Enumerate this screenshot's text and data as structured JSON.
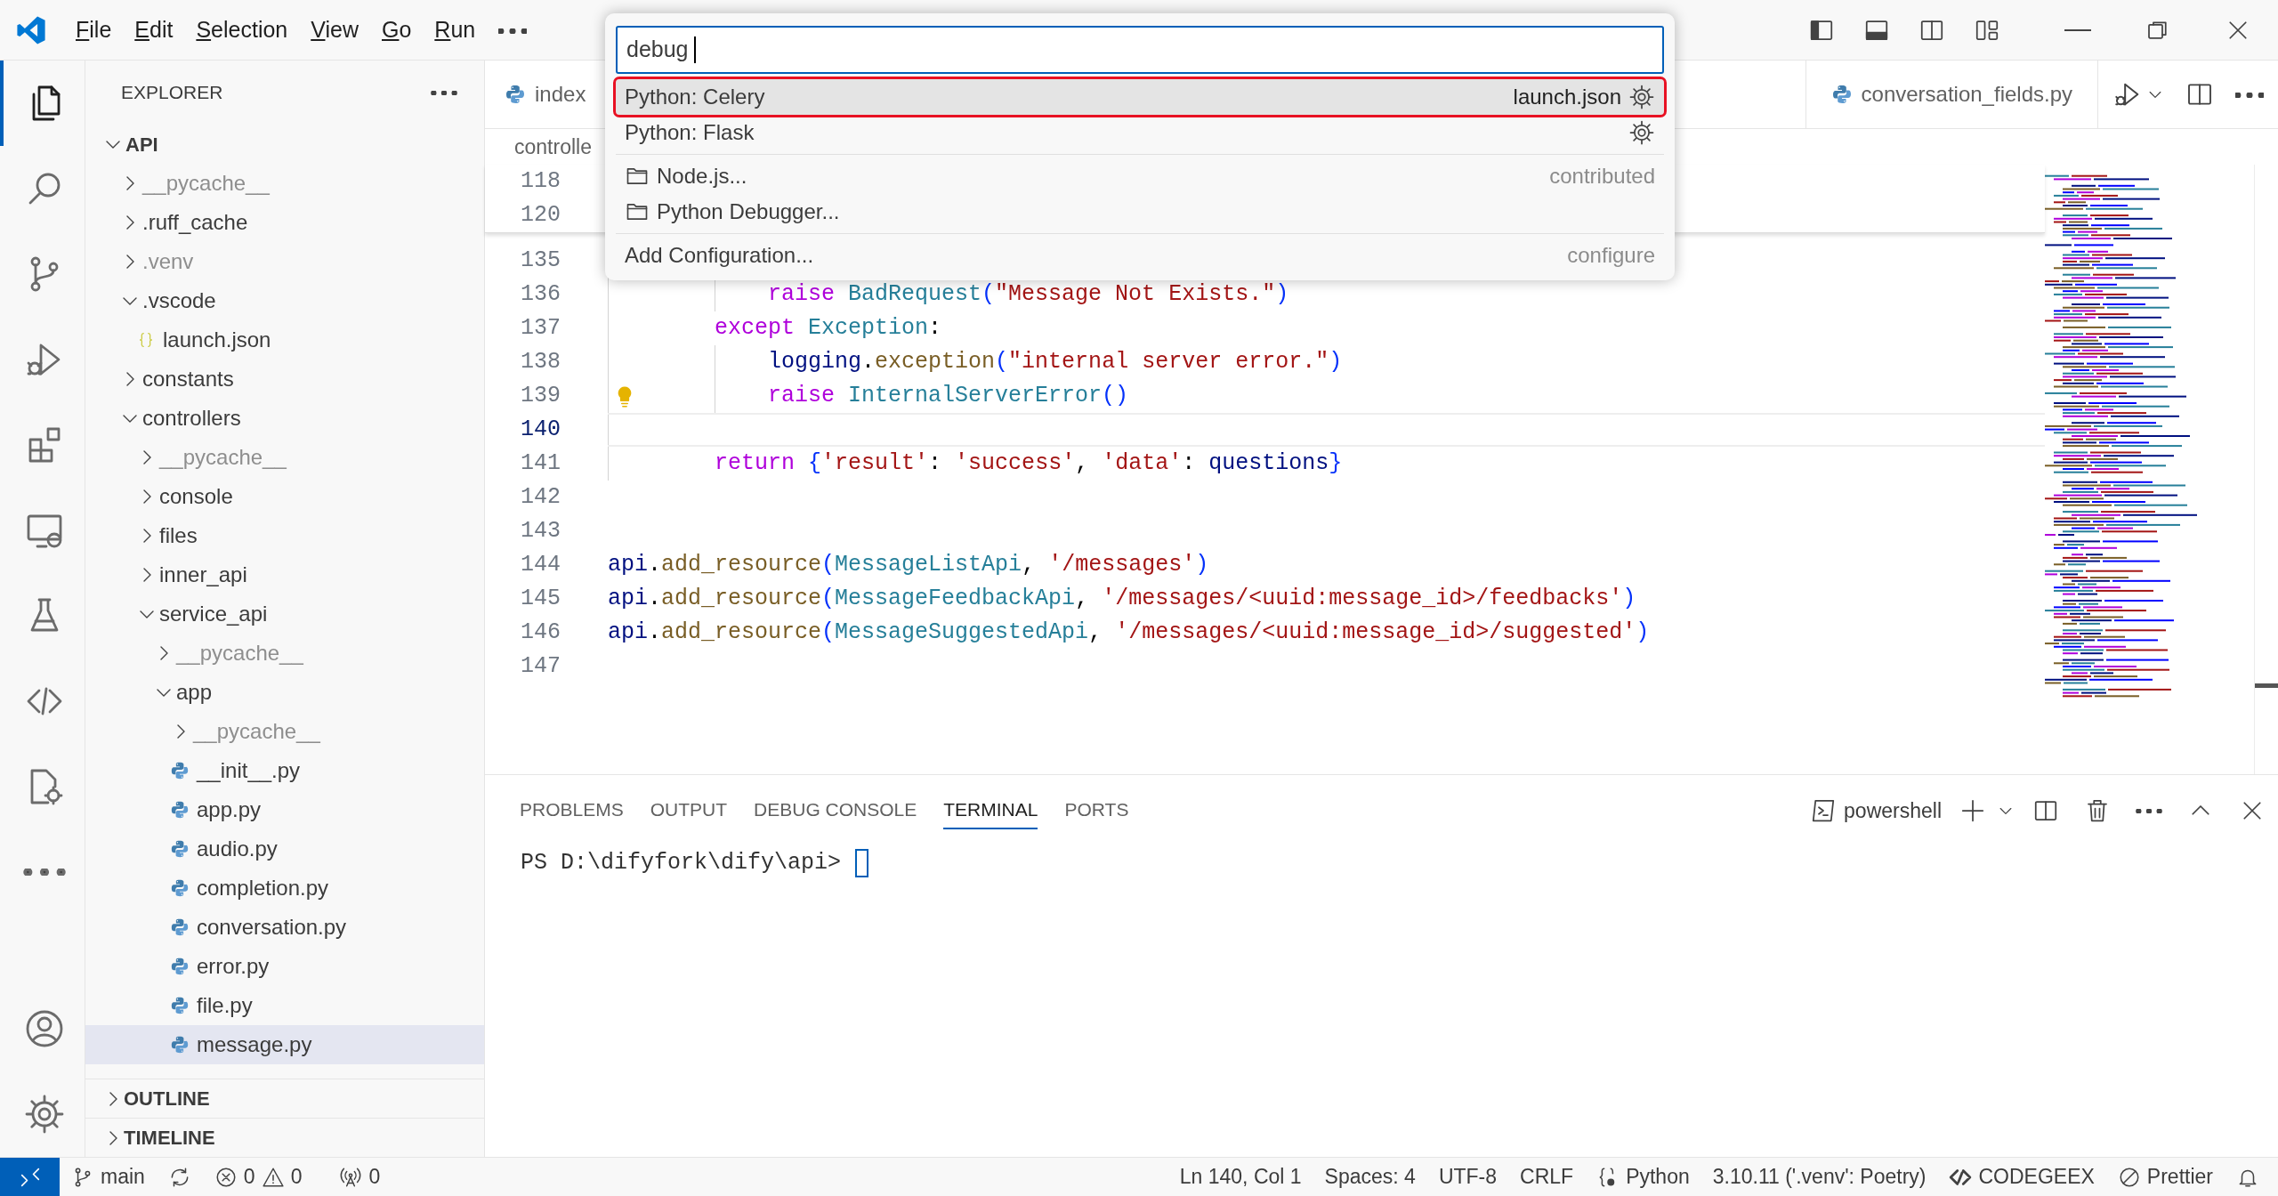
{
  "menu": [
    "File",
    "Edit",
    "Selection",
    "View",
    "Go",
    "Run"
  ],
  "quick_pick": {
    "value": "debug",
    "items": [
      {
        "label": "Python: Celery",
        "detail": "launch.json",
        "kind": "config",
        "selected": true
      },
      {
        "label": "Python: Flask",
        "kind": "config",
        "selected": false
      },
      {
        "label": "Node.js...",
        "detail": "contributed",
        "kind": "folder",
        "selected": false
      },
      {
        "label": "Python Debugger...",
        "kind": "folder",
        "selected": false
      },
      {
        "label": "Add Configuration...",
        "detail": "configure",
        "kind": "action",
        "selected": false
      }
    ]
  },
  "activity_bar": [
    {
      "kind": "explorer",
      "selected": true
    },
    {
      "kind": "search",
      "selected": false
    },
    {
      "kind": "source-control",
      "selected": false
    },
    {
      "kind": "run-debug",
      "selected": false
    },
    {
      "kind": "extensions",
      "selected": false
    },
    {
      "kind": "remote",
      "selected": false
    },
    {
      "kind": "testing",
      "selected": false
    },
    {
      "kind": "codegeex",
      "selected": false
    },
    {
      "kind": "doc-gear",
      "selected": false
    },
    {
      "kind": "more",
      "selected": false
    }
  ],
  "explorer": {
    "title": "EXPLORER",
    "workspace": {
      "label": "API",
      "expanded": true
    },
    "tree": [
      {
        "label": "__pycache__",
        "kind": "folder",
        "expanded": false,
        "dimmed": true,
        "selected": false
      },
      {
        "label": ".ruff_cache",
        "kind": "folder",
        "expanded": false,
        "dimmed": false,
        "selected": false
      },
      {
        "label": ".venv",
        "kind": "folder",
        "expanded": false,
        "dimmed": true,
        "selected": false
      },
      {
        "label": ".vscode",
        "kind": "folder",
        "expanded": true,
        "dimmed": false,
        "selected": false,
        "children": [
          {
            "label": "launch.json",
            "kind": "json",
            "dimmed": false,
            "selected": false
          }
        ]
      },
      {
        "label": "constants",
        "kind": "folder",
        "expanded": false,
        "dimmed": false,
        "selected": false
      },
      {
        "label": "controllers",
        "kind": "folder",
        "expanded": true,
        "dimmed": false,
        "selected": false,
        "children": [
          {
            "label": "__pycache__",
            "kind": "folder",
            "expanded": false,
            "dimmed": true,
            "selected": false
          },
          {
            "label": "console",
            "kind": "folder",
            "expanded": false,
            "dimmed": false,
            "selected": false
          },
          {
            "label": "files",
            "kind": "folder",
            "expanded": false,
            "dimmed": false,
            "selected": false
          },
          {
            "label": "inner_api",
            "kind": "folder",
            "expanded": false,
            "dimmed": false,
            "selected": false
          },
          {
            "label": "service_api",
            "kind": "folder",
            "expanded": true,
            "dimmed": false,
            "selected": false,
            "children": [
              {
                "label": "__pycache__",
                "kind": "folder",
                "expanded": false,
                "dimmed": true,
                "selected": false
              },
              {
                "label": "app",
                "kind": "folder",
                "expanded": true,
                "dimmed": false,
                "selected": false,
                "children": [
                  {
                    "label": "__pycache__",
                    "kind": "folder",
                    "expanded": false,
                    "dimmed": true,
                    "selected": false
                  },
                  {
                    "label": "__init__.py",
                    "kind": "python",
                    "dimmed": false,
                    "selected": false
                  },
                  {
                    "label": "app.py",
                    "kind": "python",
                    "dimmed": false,
                    "selected": false
                  },
                  {
                    "label": "audio.py",
                    "kind": "python",
                    "dimmed": false,
                    "selected": false
                  },
                  {
                    "label": "completion.py",
                    "kind": "python",
                    "dimmed": false,
                    "selected": false
                  },
                  {
                    "label": "conversation.py",
                    "kind": "python",
                    "dimmed": false,
                    "selected": false
                  },
                  {
                    "label": "error.py",
                    "kind": "python",
                    "dimmed": false,
                    "selected": false
                  },
                  {
                    "label": "file.py",
                    "kind": "python",
                    "dimmed": false,
                    "selected": false
                  },
                  {
                    "label": "message.py",
                    "kind": "python",
                    "dimmed": false,
                    "selected": true
                  }
                ]
              }
            ]
          }
        ]
      }
    ],
    "sections": [
      {
        "label": "OUTLINE",
        "expanded": false
      },
      {
        "label": "TIMELINE",
        "expanded": false
      }
    ]
  },
  "editor": {
    "tabs": [
      {
        "label": "index",
        "selected": false
      },
      {
        "label": "conversation_fields.py",
        "selected": false
      }
    ],
    "breadcrumb": "controlle",
    "sticky_lines": [
      "118",
      "120"
    ],
    "lines": [
      {
        "number": "135",
        "current": false,
        "lightbulb": false
      },
      {
        "number": "136",
        "current": false,
        "lightbulb": false,
        "tokens": [
          {
            "kind": "keyword",
            "text": "            raise"
          },
          {
            "kind": "class",
            "text": " BadRequest"
          },
          {
            "kind": "bracket",
            "text": "("
          },
          {
            "kind": "string",
            "text": "\"Message Not Exists.\""
          },
          {
            "kind": "bracket",
            "text": ")"
          }
        ]
      },
      {
        "number": "137",
        "current": false,
        "lightbulb": false,
        "tokens": [
          {
            "kind": "keyword",
            "text": "        except"
          },
          {
            "kind": "class",
            "text": " Exception"
          },
          {
            "kind": "plain",
            "text": ":"
          }
        ]
      },
      {
        "number": "138",
        "current": false,
        "lightbulb": false,
        "tokens": [
          {
            "kind": "variable",
            "text": "            logging"
          },
          {
            "kind": "plain",
            "text": "."
          },
          {
            "kind": "function",
            "text": "exception"
          },
          {
            "kind": "bracket",
            "text": "("
          },
          {
            "kind": "string",
            "text": "\"internal server error.\""
          },
          {
            "kind": "bracket",
            "text": ")"
          }
        ]
      },
      {
        "number": "139",
        "current": false,
        "lightbulb": true,
        "tokens": [
          {
            "kind": "keyword",
            "text": "            raise"
          },
          {
            "kind": "class",
            "text": " InternalServerError"
          },
          {
            "kind": "bracket",
            "text": "()"
          }
        ]
      },
      {
        "number": "140",
        "current": true,
        "lightbulb": false
      },
      {
        "number": "141",
        "current": false,
        "lightbulb": false,
        "tokens": [
          {
            "kind": "keyword",
            "text": "        return"
          },
          {
            "kind": "bracket",
            "text": " {"
          },
          {
            "kind": "string",
            "text": "'result'"
          },
          {
            "kind": "plain",
            "text": ":"
          },
          {
            "kind": "string",
            "text": " 'success'"
          },
          {
            "kind": "plain",
            "text": ","
          },
          {
            "kind": "string",
            "text": " 'data'"
          },
          {
            "kind": "plain",
            "text": ":"
          },
          {
            "kind": "variable",
            "text": " questions"
          },
          {
            "kind": "bracket",
            "text": "}"
          }
        ]
      },
      {
        "number": "142",
        "current": false,
        "lightbulb": false
      },
      {
        "number": "143",
        "current": false,
        "lightbulb": false
      },
      {
        "number": "144",
        "current": false,
        "lightbulb": false,
        "tokens": [
          {
            "kind": "variable",
            "text": "api"
          },
          {
            "kind": "plain",
            "text": "."
          },
          {
            "kind": "function",
            "text": "add_resource"
          },
          {
            "kind": "bracket",
            "text": "("
          },
          {
            "kind": "class",
            "text": "MessageListApi"
          },
          {
            "kind": "plain",
            "text": ","
          },
          {
            "kind": "string",
            "text": " '/messages'"
          },
          {
            "kind": "bracket",
            "text": ")"
          }
        ]
      },
      {
        "number": "145",
        "current": false,
        "lightbulb": false,
        "tokens": [
          {
            "kind": "variable",
            "text": "api"
          },
          {
            "kind": "plain",
            "text": "."
          },
          {
            "kind": "function",
            "text": "add_resource"
          },
          {
            "kind": "bracket",
            "text": "("
          },
          {
            "kind": "class",
            "text": "MessageFeedbackApi"
          },
          {
            "kind": "plain",
            "text": ","
          },
          {
            "kind": "string",
            "text": " '/messages/<uuid:message_id>/feedbacks'"
          },
          {
            "kind": "bracket",
            "text": ")"
          }
        ]
      },
      {
        "number": "146",
        "current": false,
        "lightbulb": false,
        "tokens": [
          {
            "kind": "variable",
            "text": "api"
          },
          {
            "kind": "plain",
            "text": "."
          },
          {
            "kind": "function",
            "text": "add_resource"
          },
          {
            "kind": "bracket",
            "text": "("
          },
          {
            "kind": "class",
            "text": "MessageSuggestedApi"
          },
          {
            "kind": "plain",
            "text": ","
          },
          {
            "kind": "string",
            "text": " '/messages/<uuid:message_id>/suggested'"
          },
          {
            "kind": "bracket",
            "text": ")"
          }
        ]
      },
      {
        "number": "147",
        "current": false,
        "lightbulb": false
      }
    ]
  },
  "panel": {
    "tabs": [
      {
        "label": "PROBLEMS",
        "selected": false
      },
      {
        "label": "OUTPUT",
        "selected": false
      },
      {
        "label": "DEBUG CONSOLE",
        "selected": false
      },
      {
        "label": "TERMINAL",
        "selected": true
      },
      {
        "label": "PORTS",
        "selected": false
      }
    ],
    "terminal_name": "powershell",
    "prompt": "PS D:\\difyfork\\dify\\api>"
  },
  "status_bar": {
    "branch": "main",
    "errors": "0",
    "warnings": "0",
    "ports": "0",
    "items": [
      {
        "text": "Ln 140, Col 1",
        "kind": "plain"
      },
      {
        "text": "Spaces: 4",
        "kind": "plain"
      },
      {
        "text": "UTF-8",
        "kind": "plain"
      },
      {
        "text": "CRLF",
        "kind": "plain"
      },
      {
        "text": "Python",
        "kind": "language"
      },
      {
        "text": "3.10.11 ('.venv': Poetry)",
        "kind": "plain"
      },
      {
        "text": "CODEGEEX",
        "kind": "codegeex"
      },
      {
        "text": "Prettier",
        "kind": "formatter"
      }
    ]
  }
}
